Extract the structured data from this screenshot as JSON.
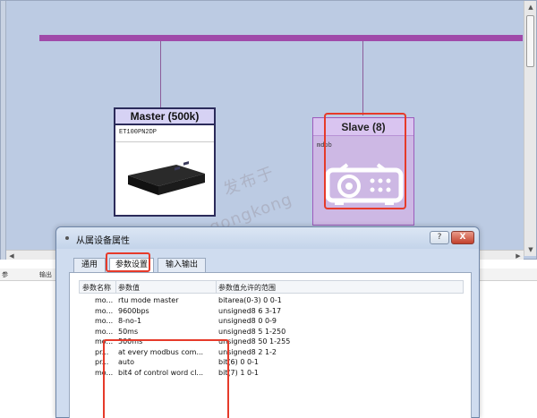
{
  "canvas": {
    "master": {
      "title": "Master (500k)",
      "model": "ET100PN2DP"
    },
    "slave": {
      "title": "Slave (8)",
      "protocol": "mdpb"
    }
  },
  "lower_panel": {
    "header_col1": "参",
    "header_col2": "输出"
  },
  "watermark": {
    "line1": "发布于",
    "line2": "gongkong"
  },
  "dialog": {
    "title": "从属设备属性",
    "help_label": "?",
    "close_label": "X",
    "tabs": [
      {
        "label": "通用"
      },
      {
        "label": "参数设置",
        "active": true
      },
      {
        "label": "输入输出"
      }
    ],
    "columns": [
      "参数名称",
      "参数值",
      "参数值允许的范围"
    ],
    "rows": [
      {
        "name": "mo...",
        "value": "rtu mode master",
        "range": "bitarea(0-3) 0 0-1"
      },
      {
        "name": "mo...",
        "value": "9600bps",
        "range": "unsigned8 6 3-17"
      },
      {
        "name": "mo...",
        "value": "8-no-1",
        "range": "unsigned8 0 0-9"
      },
      {
        "name": "mo...",
        "value": "50ms",
        "range": "unsigned8 5 1-250"
      },
      {
        "name": "mo...",
        "value": "500ms",
        "range": "unsigned8 50 1-255"
      },
      {
        "name": "pr...",
        "value": "at every modbus com...",
        "range": "unsigned8 2 1-2"
      },
      {
        "name": "pr...",
        "value": "auto",
        "range": "bit(6) 0 0-1"
      },
      {
        "name": "mo...",
        "value": "bit4 of control word cl...",
        "range": "bit(7) 1 0-1"
      }
    ]
  },
  "colors": {
    "bus": "#a04aa9",
    "highlight": "#e63a2a",
    "canvas_bg": "#bccbe3"
  }
}
